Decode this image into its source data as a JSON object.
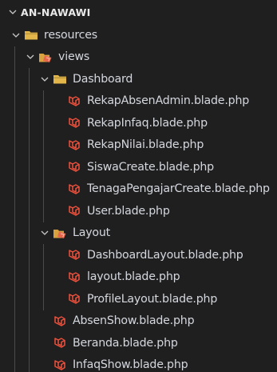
{
  "explorer": {
    "root_label": "AN-NAWAWI",
    "tree": [
      {
        "label": "resources",
        "type": "folder",
        "icon": "folder-icon",
        "depth": 1,
        "expanded": true
      },
      {
        "label": "views",
        "type": "folder",
        "icon": "views-folder-icon",
        "depth": 2,
        "expanded": true
      },
      {
        "label": "Dashboard",
        "type": "folder",
        "icon": "folder-icon",
        "depth": 3,
        "expanded": true
      },
      {
        "label": "RekapAbsenAdmin.blade.php",
        "type": "file",
        "icon": "laravel-blade-icon",
        "depth": 4
      },
      {
        "label": "RekapInfaq.blade.php",
        "type": "file",
        "icon": "laravel-blade-icon",
        "depth": 4
      },
      {
        "label": "RekapNilai.blade.php",
        "type": "file",
        "icon": "laravel-blade-icon",
        "depth": 4
      },
      {
        "label": "SiswaCreate.blade.php",
        "type": "file",
        "icon": "laravel-blade-icon",
        "depth": 4
      },
      {
        "label": "TenagaPengajarCreate.blade.php",
        "type": "file",
        "icon": "laravel-blade-icon",
        "depth": 4
      },
      {
        "label": "User.blade.php",
        "type": "file",
        "icon": "laravel-blade-icon",
        "depth": 4
      },
      {
        "label": "Layout",
        "type": "folder",
        "icon": "layout-folder-icon",
        "depth": 3,
        "expanded": true
      },
      {
        "label": "DashboardLayout.blade.php",
        "type": "file",
        "icon": "laravel-blade-icon",
        "depth": 4
      },
      {
        "label": "layout.blade.php",
        "type": "file",
        "icon": "laravel-blade-icon",
        "depth": 4
      },
      {
        "label": "ProfileLayout.blade.php",
        "type": "file",
        "icon": "laravel-blade-icon",
        "depth": 4
      },
      {
        "label": "AbsenShow.blade.php",
        "type": "file",
        "icon": "laravel-blade-icon",
        "depth": 3
      },
      {
        "label": "Beranda.blade.php",
        "type": "file",
        "icon": "laravel-blade-icon",
        "depth": 3
      },
      {
        "label": "InfaqShow.blade.php",
        "type": "file",
        "icon": "laravel-blade-icon",
        "depth": 3
      }
    ]
  },
  "colors": {
    "background": "#1f1f1f",
    "text": "#d4d7de",
    "folder": "#e2b64a",
    "views_folder": "#e7654a",
    "blade": "#f0513d",
    "guide": "#4a4a4a"
  }
}
